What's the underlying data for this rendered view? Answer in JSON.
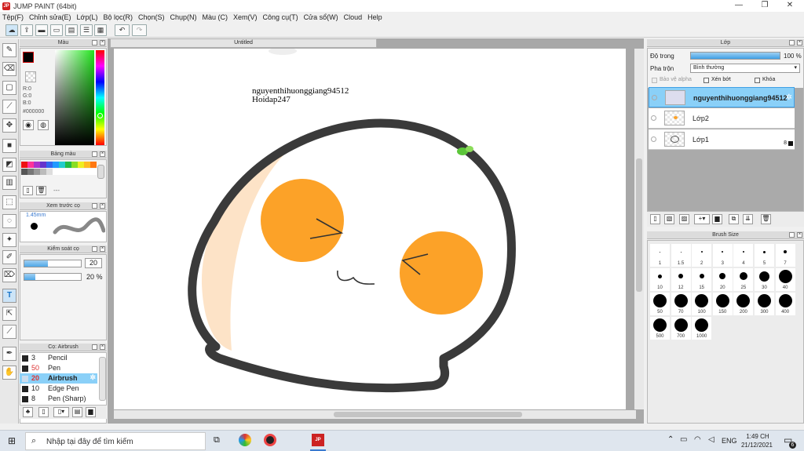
{
  "window": {
    "title": "JUMP PAINT (64bit)",
    "minimize": "—",
    "maximize": "❐",
    "close": "✕"
  },
  "menu": [
    "Tệp(F)",
    "Chỉnh sửa(E)",
    "Lớp(L)",
    "Bộ lọc(R)",
    "Chọn(S)",
    "Chụp(N)",
    "Màu (C)",
    "Xem(V)",
    "Công cụ(T)",
    "Cửa sổ(W)",
    "Cloud",
    "Help"
  ],
  "color_panel": {
    "title": "Màu",
    "r": "R:0",
    "g": "G:0",
    "b": "B:0",
    "hex": "#000000"
  },
  "palette_panel": {
    "title": "Bảng màu",
    "dashes": "---"
  },
  "brush_preview": {
    "title": "Xem trước cọ",
    "size": "1.45mm"
  },
  "brush_control": {
    "title": "Kiểm soát cọ",
    "size_value": "20",
    "opacity_value": "20 %"
  },
  "brush_list": {
    "title": "Cọ: Airbrush",
    "items": [
      {
        "size": "3",
        "name": "Pencil"
      },
      {
        "size": "50",
        "name": "Pen"
      },
      {
        "size": "20",
        "name": "Airbrush"
      },
      {
        "size": "10",
        "name": "Edge Pen"
      },
      {
        "size": "8",
        "name": "Pen (Sharp)"
      }
    ]
  },
  "document": {
    "tab": "Untitled",
    "text_line1": "nguyenthihuonggiang94512",
    "text_line2": "Hoidap247"
  },
  "layer_panel": {
    "title": "Lớp",
    "opacity_label": "Độ trong",
    "opacity_value": "100 %",
    "opacity_fraction": 1.0,
    "blend_label": "Pha trộn",
    "blend_value": "Bình thường",
    "protect_alpha": "Bảo vệ alpha",
    "clipping": "Xén bớt",
    "lock": "Khóa",
    "layers": [
      {
        "name": "nguyenthihuonggiang94512"
      },
      {
        "name": "Lớp2"
      },
      {
        "name": "Lớp1",
        "badge": "8"
      }
    ]
  },
  "brush_size_panel": {
    "title": "Brush Size",
    "sizes": [
      "1",
      "1.5",
      "2",
      "3",
      "4",
      "5",
      "7",
      "10",
      "12",
      "15",
      "20",
      "25",
      "30",
      "40",
      "50",
      "70",
      "100",
      "150",
      "200",
      "300",
      "400",
      "500",
      "700",
      "1000"
    ]
  },
  "taskbar": {
    "search_placeholder": "Nhập tại đây để tìm kiếm",
    "lang": "ENG",
    "time": "1:49 CH",
    "date": "21/12/2021",
    "notif_count": "6"
  },
  "colors": {
    "accent": "#4ea8e8",
    "selected_layer": "#8ad0f8",
    "orange": "#fca228",
    "outline": "#3a3a3a",
    "skin": "#fde3c7"
  }
}
